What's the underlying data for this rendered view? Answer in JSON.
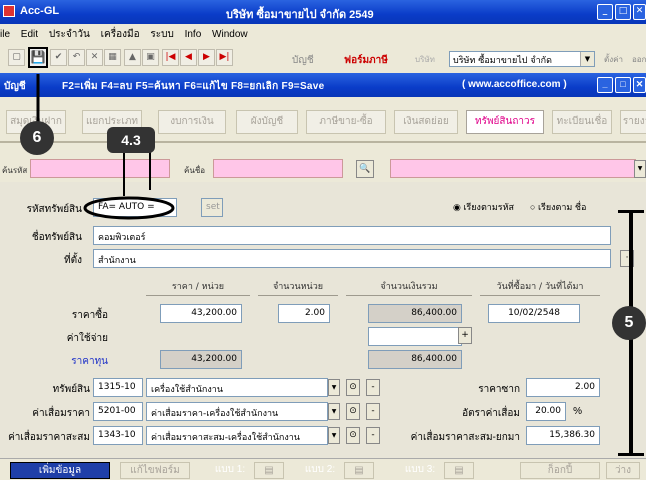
{
  "window": {
    "app_name": "Acc-GL",
    "document_title": "บริษัท ซื้อมาขายไป จำกัด 2549",
    "min": "_",
    "max": "□",
    "close": "✕"
  },
  "menu": [
    "ile",
    "Edit",
    "ประจำวัน",
    "เครื่องมือ",
    "ระบบ",
    "Info",
    "Window"
  ],
  "toolbar": {
    "buttons": [
      "▢",
      "✔",
      "↶",
      "✕",
      "▦",
      "▲",
      "▣",
      "|◀",
      "◀",
      "▶",
      "▶|"
    ],
    "links": {
      "account": "บัญชี",
      "tax_form": "ฟอร์มภาษี",
      "company": "บริษัท"
    },
    "company_value": "บริษัท ซื้อมาขายไป จำกัด",
    "setup": "ตั้งค่า",
    "logout": "ออก",
    "save_icon": "💾"
  },
  "subbar": {
    "label": "บัญชี",
    "hotkeys": "F2=เพิ่ม F4=ลบ F5=ค้นหา F6=แก้ไข F8=ยกเลิก F9=Save",
    "url": "( www.accoffice.com )"
  },
  "tabs": [
    "สมุดเงินฝาก",
    "แยกประเภท",
    "งบการเงิน",
    "ผังบัญชี",
    "ภาษีขาย-ซื้อ",
    "เงินสดย่อย",
    "ทรัพย์สินถาวร",
    "ทะเบียนเชื่อ",
    "รายงาน"
  ],
  "search": {
    "code_label": "ค้นรหัส",
    "name_label": "ค้นชื่อ",
    "binoc": "🔍"
  },
  "form": {
    "asset_code_label": "รหัสทรัพย์สิน",
    "asset_code_value": "FA= AUTO =",
    "set_button": "set",
    "sort_by_code": "เรียงตามรหัส",
    "sort_by_name": "เรียงตาม ชื่อ",
    "asset_name_label": "ชื่อทรัพย์สิน",
    "asset_name_value": "คอมพิวเตอร์",
    "location_label": "ที่ตั้ง",
    "location_value": "สำนักงาน",
    "side_button": "·",
    "headers": [
      "ราคา / หน่วย",
      "จำนวนหน่วย",
      "จำนวนเงินรวม",
      "วันที่ซื้อมา / วันที่ได้มา"
    ],
    "purchase_price_label": "ราคาซื้อ",
    "purchase_unit_price": "43,200.00",
    "units": "2.00",
    "purchase_total": "86,400.00",
    "purchase_date": "10/02/2548",
    "expense_label": "ค่าใช้จ่าย",
    "expense_total": "",
    "plus": "+",
    "cost_label": "ราคาทุน",
    "cost_unit": "43,200.00",
    "cost_total": "86,400.00"
  },
  "accounts": [
    {
      "label": "ทรัพย์สิน",
      "code": "1315-10",
      "name": "เครื่องใช้สำนักงาน"
    },
    {
      "label": "ค่าเสื่อมราคา",
      "code": "5201-00",
      "name": "ค่าเสื่อมราคา-เครื่องใช้สำนักงาน"
    },
    {
      "label": "ค่าเสื่อมราคาสะสม",
      "code": "1343-10",
      "name": "ค่าเสื่อมราคาสะสม-เครื่องใช้สำนักงาน"
    }
  ],
  "right_fields": {
    "salvage_label": "ราคาซาก",
    "salvage_value": "2.00",
    "rate_label": "อัตราค่าเสื่อม",
    "rate_value": "20.00",
    "pct": "%",
    "accum_label": "ค่าเสื่อมราคาสะสม-ยกมา",
    "accum_value": "15,386.30"
  },
  "footer": {
    "add": "เพิ่มข้อมูล",
    "edit": "แก้ไขฟอร์ม",
    "form1": "แบบ 1:",
    "form2": "แบบ 2:",
    "form3": "แบบ 3:",
    "save_next": "ก็อกปี้",
    "empty": "ว่าง"
  },
  "callouts": {
    "c6": "6",
    "c43": "4.3",
    "c5": "5"
  },
  "colors": {
    "title_blue": "#0a3cc8",
    "active_tab": "#e0008a",
    "pink_field": "#ffc6e8"
  }
}
